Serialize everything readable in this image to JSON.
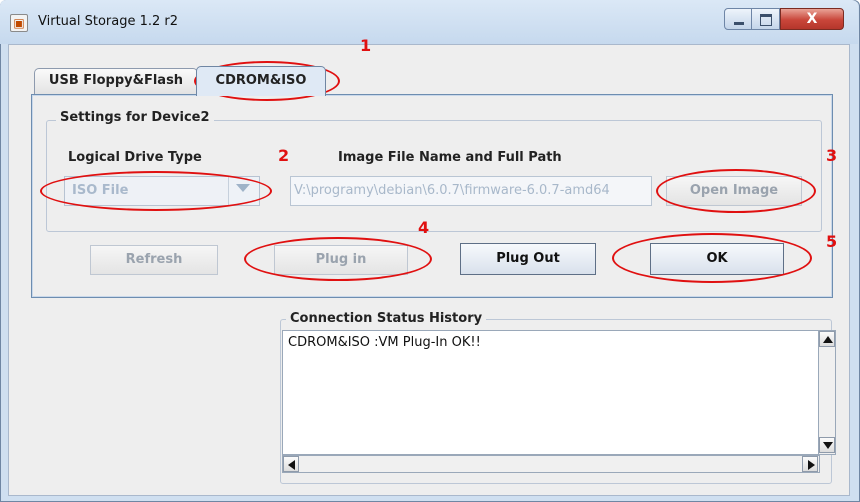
{
  "window": {
    "title": "Virtual Storage 1.2 r2",
    "close_glyph": "X",
    "icons": [
      "app-icon",
      "minimize-icon",
      "maximize-icon",
      "close-icon"
    ]
  },
  "tabs": [
    {
      "label": "USB Floppy&Flash",
      "selected": false
    },
    {
      "label": "CDROM&ISO",
      "selected": true
    }
  ],
  "device": {
    "legend": "Settings for Device2",
    "drive_type_label": "Logical Drive Type",
    "drive_type_value": "ISO File",
    "path_label": "Image File Name and Full Path",
    "path_value": "V:\\programy\\debian\\6.0.7\\firmware-6.0.7-amd64",
    "open_image_label": "Open Image"
  },
  "buttons": {
    "refresh": "Refresh",
    "plug_in": "Plug in",
    "plug_out": "Plug Out",
    "ok": "OK"
  },
  "annotations": {
    "n1": "1",
    "n2": "2",
    "n3": "3",
    "n4": "4",
    "n5": "5",
    "color": "#e01010"
  },
  "history": {
    "legend": "Connection Status History",
    "lines": [
      "CDROM&ISO :VM Plug-In OK!!"
    ]
  }
}
